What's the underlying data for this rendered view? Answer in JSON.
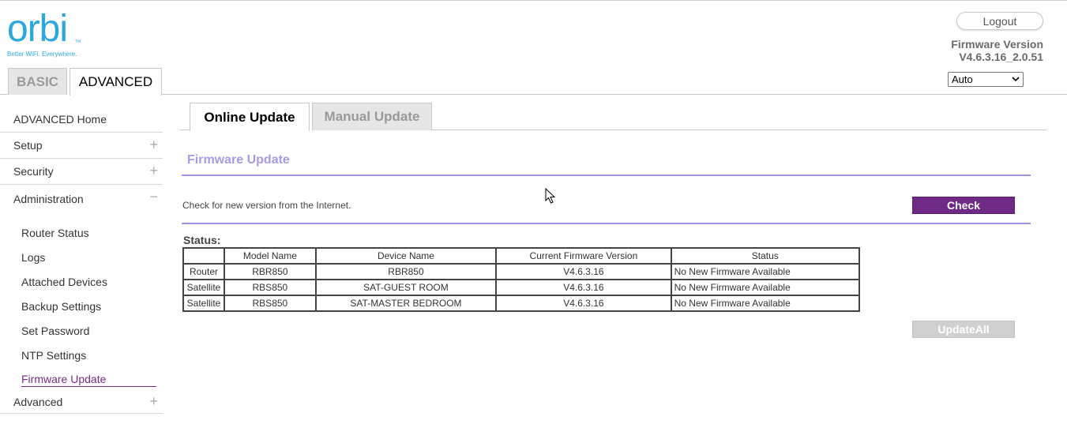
{
  "logo": {
    "word": "orbi",
    "tm": "TM",
    "tagline": "Better WiFi. Everywhere."
  },
  "main_tabs": [
    {
      "label": "BASIC",
      "active": false
    },
    {
      "label": "ADVANCED",
      "active": true
    }
  ],
  "header": {
    "logout_label": "Logout",
    "firmware_label": "Firmware Version",
    "firmware_value": "V4.6.3.16_2.0.51",
    "language_selected": "Auto"
  },
  "sidebar": {
    "items": [
      {
        "label": "ADVANCED Home"
      },
      {
        "label": "Setup",
        "toggle": "+"
      },
      {
        "label": "Security",
        "toggle": "+"
      },
      {
        "label": "Administration",
        "toggle": "−"
      }
    ],
    "admin_sub": [
      {
        "label": "Router Status"
      },
      {
        "label": "Logs"
      },
      {
        "label": "Attached Devices"
      },
      {
        "label": "Backup Settings"
      },
      {
        "label": "Set Password"
      },
      {
        "label": "NTP Settings"
      },
      {
        "label": "Firmware Update",
        "active": true
      }
    ],
    "after": [
      {
        "label": "Advanced",
        "toggle": "+"
      }
    ]
  },
  "content_tabs": [
    {
      "label": "Online Update",
      "active": true
    },
    {
      "label": "Manual Update",
      "active": false
    }
  ],
  "main": {
    "section_title": "Firmware Update",
    "check_text": "Check for new version from the Internet.",
    "check_button": "Check",
    "status_label": "Status:",
    "update_all_button": "UpdateAll",
    "table": {
      "headers": [
        "",
        "Model Name",
        "Device Name",
        "Current Firmware Version",
        "Status"
      ],
      "rows": [
        [
          "Router",
          "RBR850",
          "RBR850",
          "V4.6.3.16",
          "No New Firmware Available"
        ],
        [
          "Satellite",
          "RBS850",
          "SAT-GUEST ROOM",
          "V4.6.3.16",
          "No New Firmware Available"
        ],
        [
          "Satellite",
          "RBS850",
          "SAT-MASTER BEDROOM",
          "V4.6.3.16",
          "No New Firmware Available"
        ]
      ]
    }
  },
  "colors": {
    "brand_blue": "#2aa7e0",
    "accent_purple": "#6f2a86",
    "section_lavender": "#a89ae8"
  }
}
